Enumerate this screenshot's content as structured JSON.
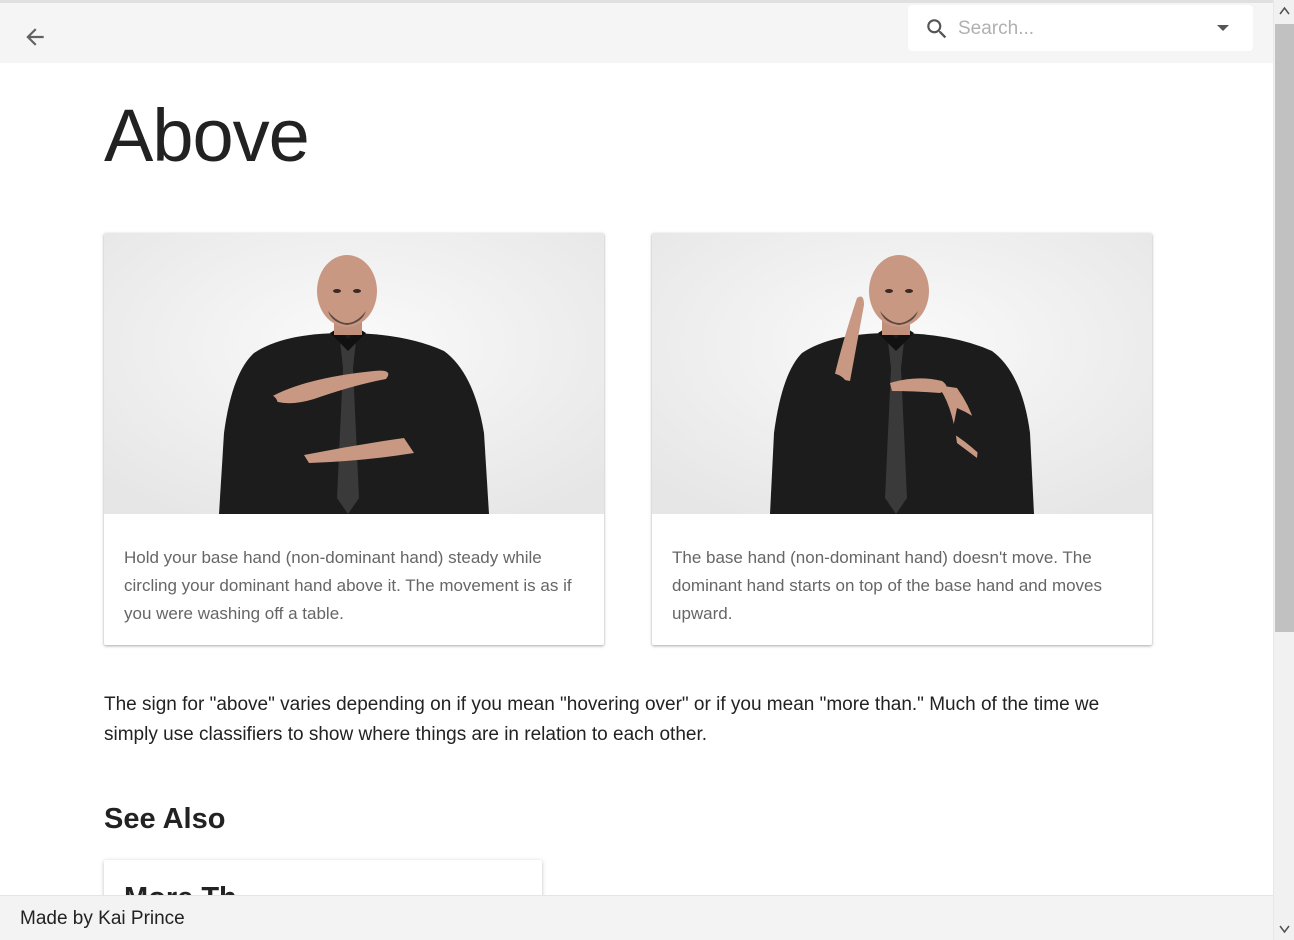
{
  "header": {
    "search_placeholder": "Search..."
  },
  "page": {
    "title": "Above"
  },
  "cards": [
    {
      "image_alt": "Man in black shirt signing with both hands flat, one above the other",
      "text": "Hold your base hand (non-dominant hand) steady while circling your dominant hand above it. The movement is as if you were washing off a table."
    },
    {
      "image_alt": "Man in black shirt signing with dominant hand raised upward above base hand",
      "text": "The base hand (non-dominant hand) doesn't move. The dominant hand starts on top of the base hand and moves upward."
    }
  ],
  "description": "The sign for \"above\" varies depending on if you mean \"hovering over\" or if you mean \"more than.\" Much of the time we simply use classifiers to show where things are in relation to each other.",
  "see_also": {
    "heading": "See Also",
    "items": [
      {
        "title": "More Th"
      }
    ]
  },
  "footer": {
    "text": "Made by Kai Prince"
  },
  "colors": {
    "topbar_bg": "#f5f5f5",
    "footer_bg": "#f3f3f3",
    "shirt": "#1c1c1c",
    "skin": "#c99882"
  }
}
